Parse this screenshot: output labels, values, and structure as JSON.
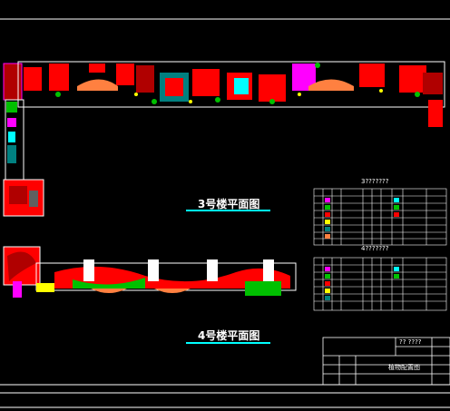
{
  "drawing": {
    "floor3_title": "3号楼平面图",
    "floor4_title": "4号楼平面图",
    "table3_title": "3???????",
    "table4_title": "4???????",
    "title_block_name": "植物配置图",
    "title_block_code": "?? ????",
    "colors": {
      "background": "#000000",
      "line_white": "#ffffff",
      "red": "#ff0000",
      "dark_red": "#b00000",
      "magenta": "#ff00ff",
      "cyan": "#00ffff",
      "green": "#00c000",
      "yellow": "#ffff00",
      "orange": "#ff8040",
      "teal": "#008080"
    }
  }
}
